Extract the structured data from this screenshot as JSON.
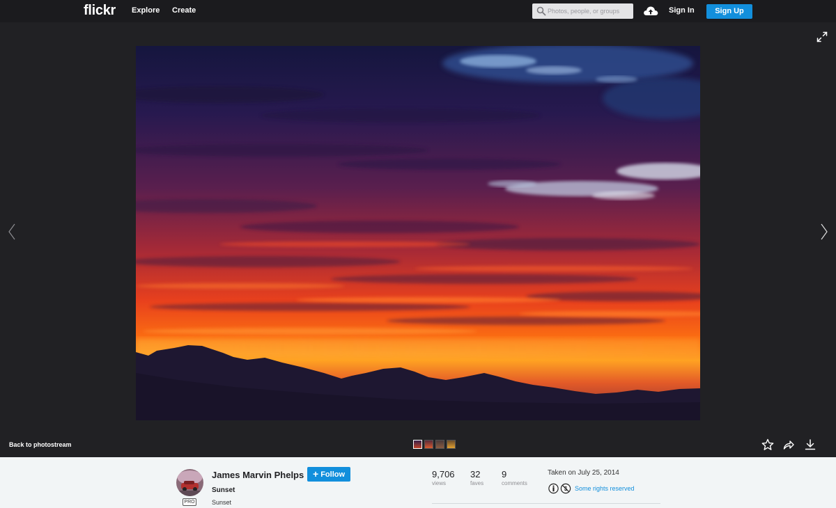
{
  "nav": {
    "logo": "flickr",
    "links": [
      "Explore",
      "Create"
    ],
    "search_placeholder": "Photos, people, or groups",
    "sign_in": "Sign In",
    "sign_up": "Sign Up"
  },
  "stage": {
    "back_link": "Back to photostream",
    "thumbnail_count": 4
  },
  "info": {
    "owner": "James Marvin Phelps",
    "badge": "PRO",
    "follow_label": "Follow",
    "title": "Sunset",
    "description": "Sunset",
    "stats": [
      {
        "value": "9,706",
        "label": "views"
      },
      {
        "value": "32",
        "label": "faves"
      },
      {
        "value": "9",
        "label": "comments"
      }
    ],
    "taken": "Taken on July 25, 2014",
    "license": "Some rights reserved"
  },
  "colors": {
    "accent": "#128fdc",
    "background": "#212124",
    "nav_bg": "#1b1b1e",
    "panel_bg": "#f2f5f6"
  },
  "icons": [
    "search-icon",
    "upload-cloud-icon",
    "expand-icon",
    "chevron-left-icon",
    "chevron-right-icon",
    "star-icon",
    "share-icon",
    "download-icon",
    "attribution-icon",
    "noncommercial-icon"
  ]
}
